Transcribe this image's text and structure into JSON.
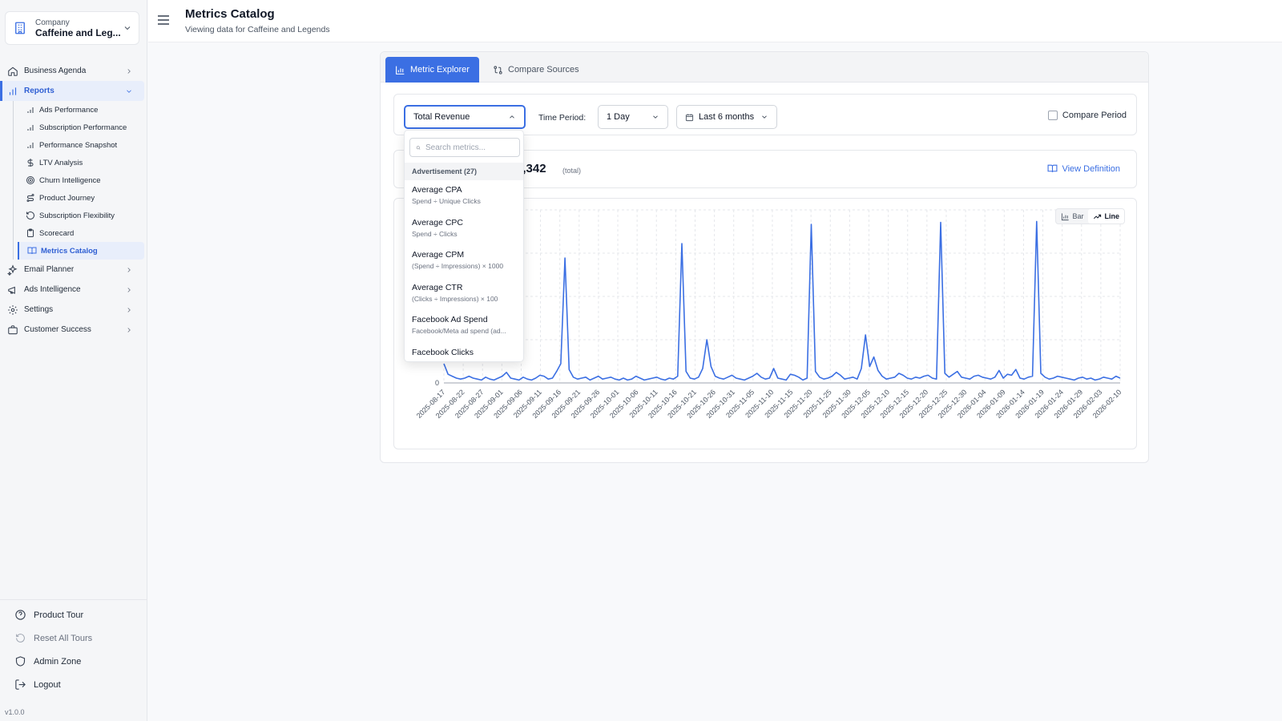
{
  "company": {
    "label": "Company",
    "name": "Caffeine and Leg..."
  },
  "nav": {
    "business_agenda": "Business Agenda",
    "reports": "Reports",
    "reports_sub": [
      "Ads Performance",
      "Subscription Performance",
      "Performance Snapshot",
      "LTV Analysis",
      "Churn Intelligence",
      "Product Journey",
      "Subscription Flexibility",
      "Scorecard",
      "Metrics Catalog"
    ],
    "email_planner": "Email Planner",
    "ads_intelligence": "Ads Intelligence",
    "settings": "Settings",
    "customer_success": "Customer Success"
  },
  "bottom_nav": {
    "product_tour": "Product Tour",
    "reset_tours": "Reset All Tours",
    "admin_zone": "Admin Zone",
    "logout": "Logout",
    "version": "v1.0.0"
  },
  "header": {
    "title": "Metrics Catalog",
    "subtitle": "Viewing data for Caffeine and Legends"
  },
  "tabs": {
    "explorer": "Metric Explorer",
    "compare": "Compare Sources"
  },
  "controls": {
    "metric": "Total Revenue",
    "time_period_label": "Time Period:",
    "time_period": "1 Day",
    "range": "Last 6 months",
    "compare_period": "Compare Period"
  },
  "summary": {
    "total_value": "3,342",
    "total_label": "(total)",
    "view_definition": "View Definition"
  },
  "chart_toggle": {
    "bar": "Bar",
    "line": "Line"
  },
  "dropdown": {
    "search_placeholder": "Search metrics...",
    "group": "Advertisement (27)",
    "options": [
      {
        "name": "Average CPA",
        "formula": "Spend ÷ Unique Clicks"
      },
      {
        "name": "Average CPC",
        "formula": "Spend ÷ Clicks"
      },
      {
        "name": "Average CPM",
        "formula": "(Spend ÷ Impressions) × 1000"
      },
      {
        "name": "Average CTR",
        "formula": "(Clicks ÷ Impressions) × 100"
      },
      {
        "name": "Facebook Ad Spend",
        "formula": "Facebook/Meta ad spend (ad..."
      },
      {
        "name": "Facebook Clicks",
        "formula": ""
      }
    ]
  },
  "colors": {
    "accent": "#3b6fe3",
    "line": "#3b6fe3"
  },
  "chart_data": {
    "type": "line",
    "title": "",
    "xlabel": "",
    "ylabel": "",
    "x_ticks": [
      "2025-08-17",
      "2025-08-22",
      "2025-08-27",
      "2025-09-01",
      "2025-09-06",
      "2025-09-11",
      "2025-09-16",
      "2025-09-21",
      "2025-09-26",
      "2025-10-01",
      "2025-10-06",
      "2025-10-11",
      "2025-10-16",
      "2025-10-21",
      "2025-10-26",
      "2025-10-31",
      "2025-11-05",
      "2025-11-10",
      "2025-11-15",
      "2025-11-20",
      "2025-11-25",
      "2025-11-30",
      "2025-12-05",
      "2025-12-10",
      "2025-12-15",
      "2025-12-20",
      "2025-12-25",
      "2025-12-30",
      "2026-01-04",
      "2026-01-09",
      "2026-01-14",
      "2026-01-19",
      "2026-01-24",
      "2026-01-29",
      "2026-02-03",
      "2026-02-10"
    ],
    "y_ticks": [
      "0"
    ],
    "series": [
      {
        "values": [
          40,
          18,
          14,
          10,
          8,
          10,
          14,
          10,
          8,
          6,
          12,
          8,
          6,
          10,
          14,
          22,
          10,
          8,
          6,
          12,
          8,
          6,
          10,
          16,
          14,
          8,
          10,
          24,
          40,
          260,
          28,
          12,
          8,
          10,
          12,
          6,
          10,
          14,
          8,
          10,
          12,
          8,
          6,
          10,
          6,
          8,
          14,
          10,
          6,
          8,
          10,
          12,
          8,
          6,
          10,
          8,
          14,
          290,
          24,
          10,
          8,
          12,
          30,
          90,
          34,
          14,
          10,
          8,
          12,
          16,
          10,
          8,
          6,
          10,
          14,
          20,
          12,
          8,
          10,
          30,
          10,
          8,
          6,
          18,
          16,
          12,
          6,
          10,
          330,
          24,
          12,
          8,
          10,
          14,
          22,
          16,
          8,
          10,
          12,
          8,
          30,
          100,
          34,
          54,
          26,
          14,
          8,
          10,
          12,
          20,
          16,
          10,
          8,
          12,
          10,
          14,
          16,
          10,
          8,
          334,
          20,
          12,
          18,
          24,
          12,
          10,
          8,
          14,
          16,
          12,
          10,
          8,
          12,
          26,
          10,
          18,
          16,
          28,
          10,
          8,
          12,
          14,
          336,
          20,
          12,
          8,
          10,
          14,
          12,
          10,
          8,
          6,
          10,
          12,
          8,
          10,
          6,
          8,
          12,
          10,
          8,
          14,
          10
        ]
      }
    ]
  }
}
